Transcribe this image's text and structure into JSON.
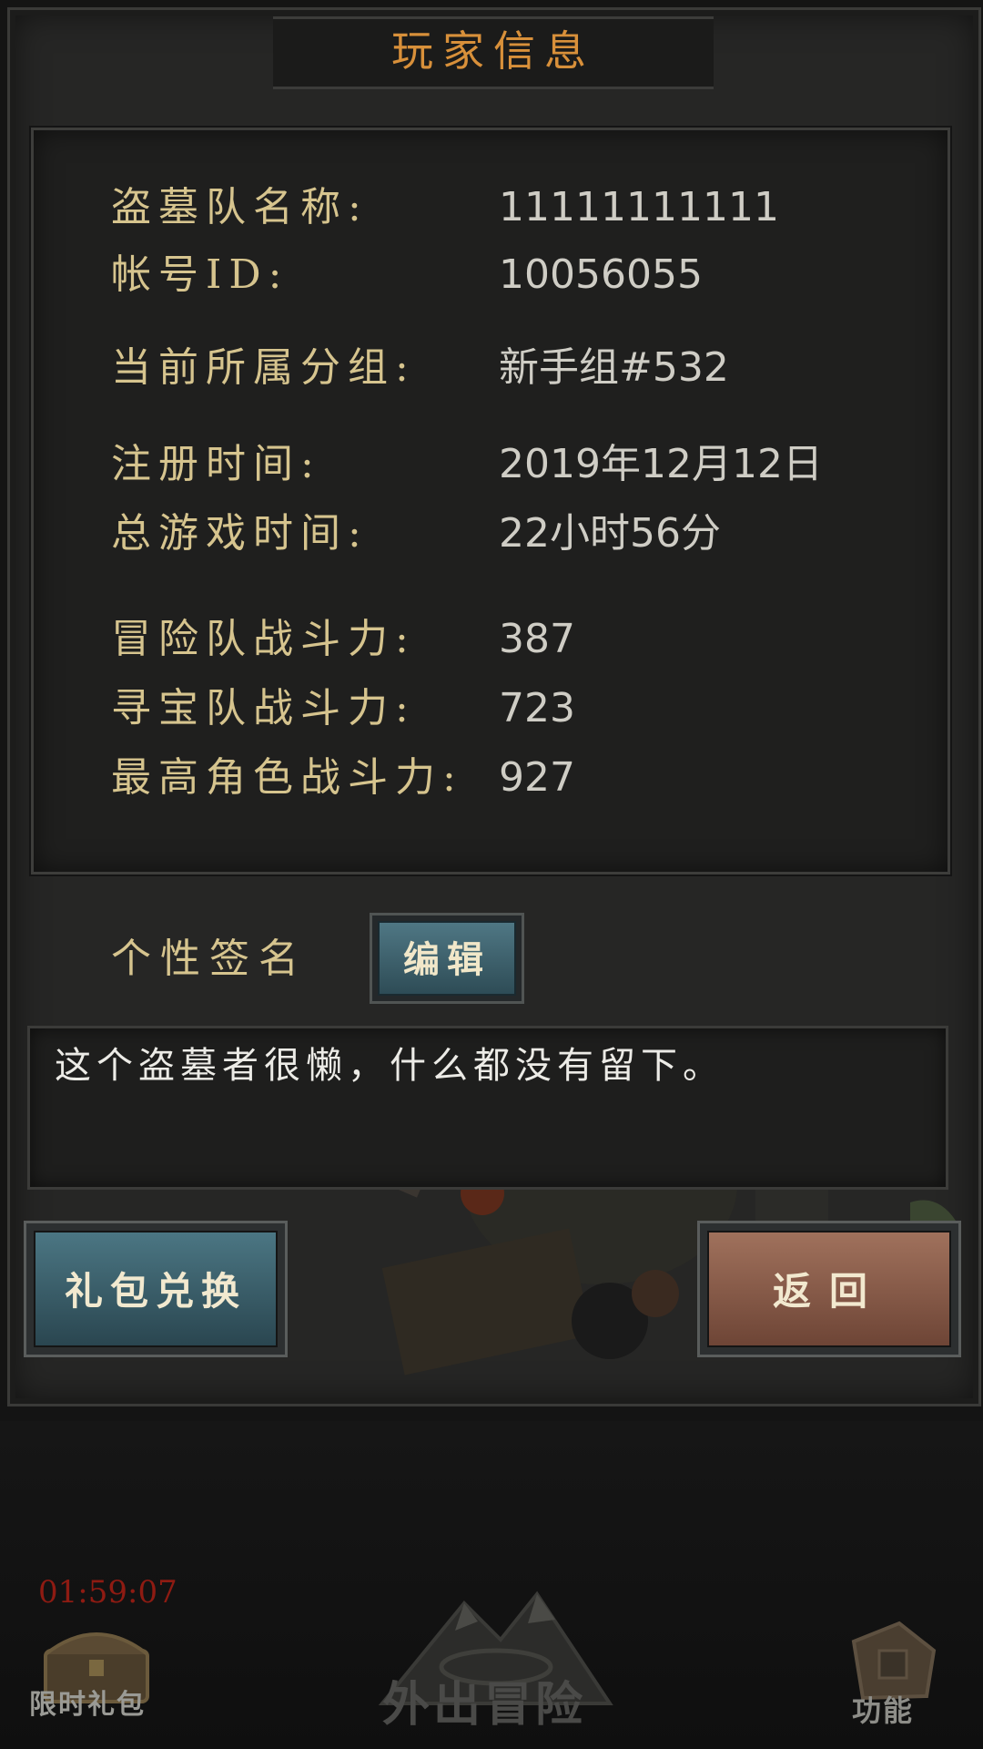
{
  "title": "玩家信息",
  "info": [
    {
      "label": "盗墓队名称:",
      "value": "11111111111"
    },
    {
      "label": "帐号ID:",
      "value": "10056055"
    },
    {
      "label": "当前所属分组:",
      "value": "新手组#532"
    },
    {
      "label": "注册时间:",
      "value": "2019年12月12日"
    },
    {
      "label": "总游戏时间:",
      "value": "22小时56分"
    },
    {
      "label": "冒险队战斗力:",
      "value": "387"
    },
    {
      "label": "寻宝队战斗力:",
      "value": "723"
    },
    {
      "label": "最高角色战斗力:",
      "value": "927"
    }
  ],
  "signature": {
    "label": "个性签名",
    "edit_label": "编辑",
    "text": "这个盗墓者很懒，什么都没有留下。"
  },
  "buttons": {
    "gift_exchange": "礼包兑换",
    "back": "返回"
  },
  "bottom_nav": {
    "timer": "01:59:07",
    "limited_gift": "限时礼包",
    "adventure": "外出冒险",
    "function": "功能"
  },
  "colors": {
    "title": "#d8903a",
    "label": "#d6c48e",
    "value": "#cfcdc5",
    "timer": "#8e1b12"
  },
  "icons": [
    "treasure-chest-icon",
    "mountain-adventure-icon",
    "backpack-function-icon"
  ]
}
